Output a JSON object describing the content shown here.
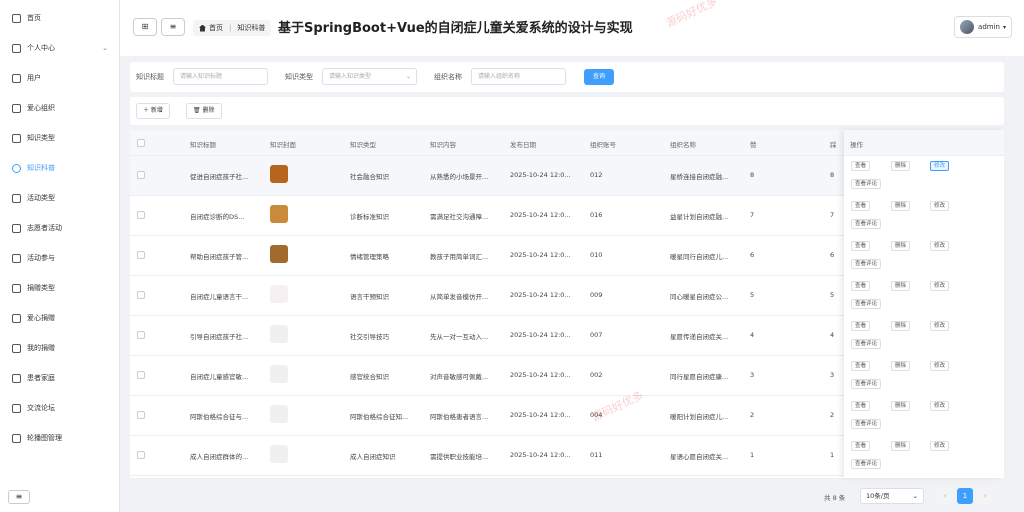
{
  "sidebar": {
    "items": [
      {
        "label": "首页",
        "icon": "home-icon"
      },
      {
        "label": "个人中心",
        "icon": "user-icon"
      },
      {
        "label": "用户",
        "icon": "user-add-icon"
      },
      {
        "label": "爱心组织",
        "icon": "org-icon"
      },
      {
        "label": "知识类型",
        "icon": "chat-icon"
      },
      {
        "label": "知识科普",
        "icon": "clock-icon"
      },
      {
        "label": "活动类型",
        "icon": "mail-icon"
      },
      {
        "label": "志愿者活动",
        "icon": "book-icon"
      },
      {
        "label": "活动参与",
        "icon": "check-square-icon"
      },
      {
        "label": "捐赠类型",
        "icon": "gift-icon"
      },
      {
        "label": "爱心捐赠",
        "icon": "document-icon"
      },
      {
        "label": "我的捐赠",
        "icon": "list-icon"
      },
      {
        "label": "患者家庭",
        "icon": "stack-icon"
      },
      {
        "label": "交流论坛",
        "icon": "forum-icon"
      },
      {
        "label": "轮播图管理",
        "icon": "card-icon"
      }
    ]
  },
  "header": {
    "breadcrumb_home": "首页",
    "breadcrumb_current": "知识科普",
    "title": "基于SpringBoot+Vue的自闭症儿童关爱系统的设计与实现",
    "username": "admin"
  },
  "search": {
    "label1": "知识标题",
    "placeholder1": "请输入知识标题",
    "label2": "知识类型",
    "placeholder2": "请输入知识类型",
    "label3": "组织名称",
    "placeholder3": "请输入组织名称",
    "button": "查询"
  },
  "toolbar": {
    "add": "新增",
    "delete": "删除"
  },
  "table": {
    "headers": [
      "知识标题",
      "知识封面",
      "知识类型",
      "知识内容",
      "发布日期",
      "组织账号",
      "组织名称",
      "赞",
      "踩",
      "操作"
    ],
    "rows": [
      {
        "title": "促进自闭症孩子社...",
        "type": "社会融合知识",
        "content": "从熟悉的小场景开...",
        "date": "2025-10-24 12:0...",
        "account": "012",
        "org": "星桥连接自闭症融...",
        "up": "8",
        "down": "8"
      },
      {
        "title": "自闭症诊断的DS...",
        "type": "诊断标准知识",
        "content": "需满足社交沟通障...",
        "date": "2025-10-24 12:0...",
        "account": "016",
        "org": "益星计划自闭症融...",
        "up": "7",
        "down": "7"
      },
      {
        "title": "帮助自闭症孩子管...",
        "type": "情绪管理策略",
        "content": "教孩子用简单词汇...",
        "date": "2025-10-24 12:0...",
        "account": "010",
        "org": "暖星同行自闭症儿...",
        "up": "6",
        "down": "6"
      },
      {
        "title": "自闭症儿童语言干...",
        "type": "语言干预知识",
        "content": "从简单发音模仿开...",
        "date": "2025-10-24 12:0...",
        "account": "009",
        "org": "同心暖星自闭症公...",
        "up": "5",
        "down": "5"
      },
      {
        "title": "引导自闭症孩子社...",
        "type": "社交引导技巧",
        "content": "先从一对一互动入...",
        "date": "2025-10-24 12:0...",
        "account": "007",
        "org": "星愿传递自闭症关...",
        "up": "4",
        "down": "4"
      },
      {
        "title": "自闭症儿童感官敏...",
        "type": "感官统合知识",
        "content": "对声音敏感可佩戴...",
        "date": "2025-10-24 12:0...",
        "account": "002",
        "org": "同行星愿自闭症康...",
        "up": "3",
        "down": "3"
      },
      {
        "title": "阿斯伯格综合征与...",
        "type": "阿斯伯格综合征知...",
        "content": "阿斯伯格患者语言...",
        "date": "2025-10-24 12:0...",
        "account": "004",
        "org": "暖阳计划自闭症儿...",
        "up": "2",
        "down": "2"
      },
      {
        "title": "成人自闭症群体的...",
        "type": "成人自闭症知识",
        "content": "需提供职业技能培...",
        "date": "2025-10-24 12:0...",
        "account": "011",
        "org": "星语心愿自闭症关...",
        "up": "1",
        "down": "1"
      }
    ],
    "ops": {
      "view": "查看",
      "delete": "删除",
      "edit": "修改",
      "review": "查看评论"
    }
  },
  "pagination": {
    "total": "共 8 条",
    "page_size": "10条/页",
    "current": "1"
  },
  "watermark": "源码好优多",
  "colors": {
    "accent": "#409eff"
  }
}
